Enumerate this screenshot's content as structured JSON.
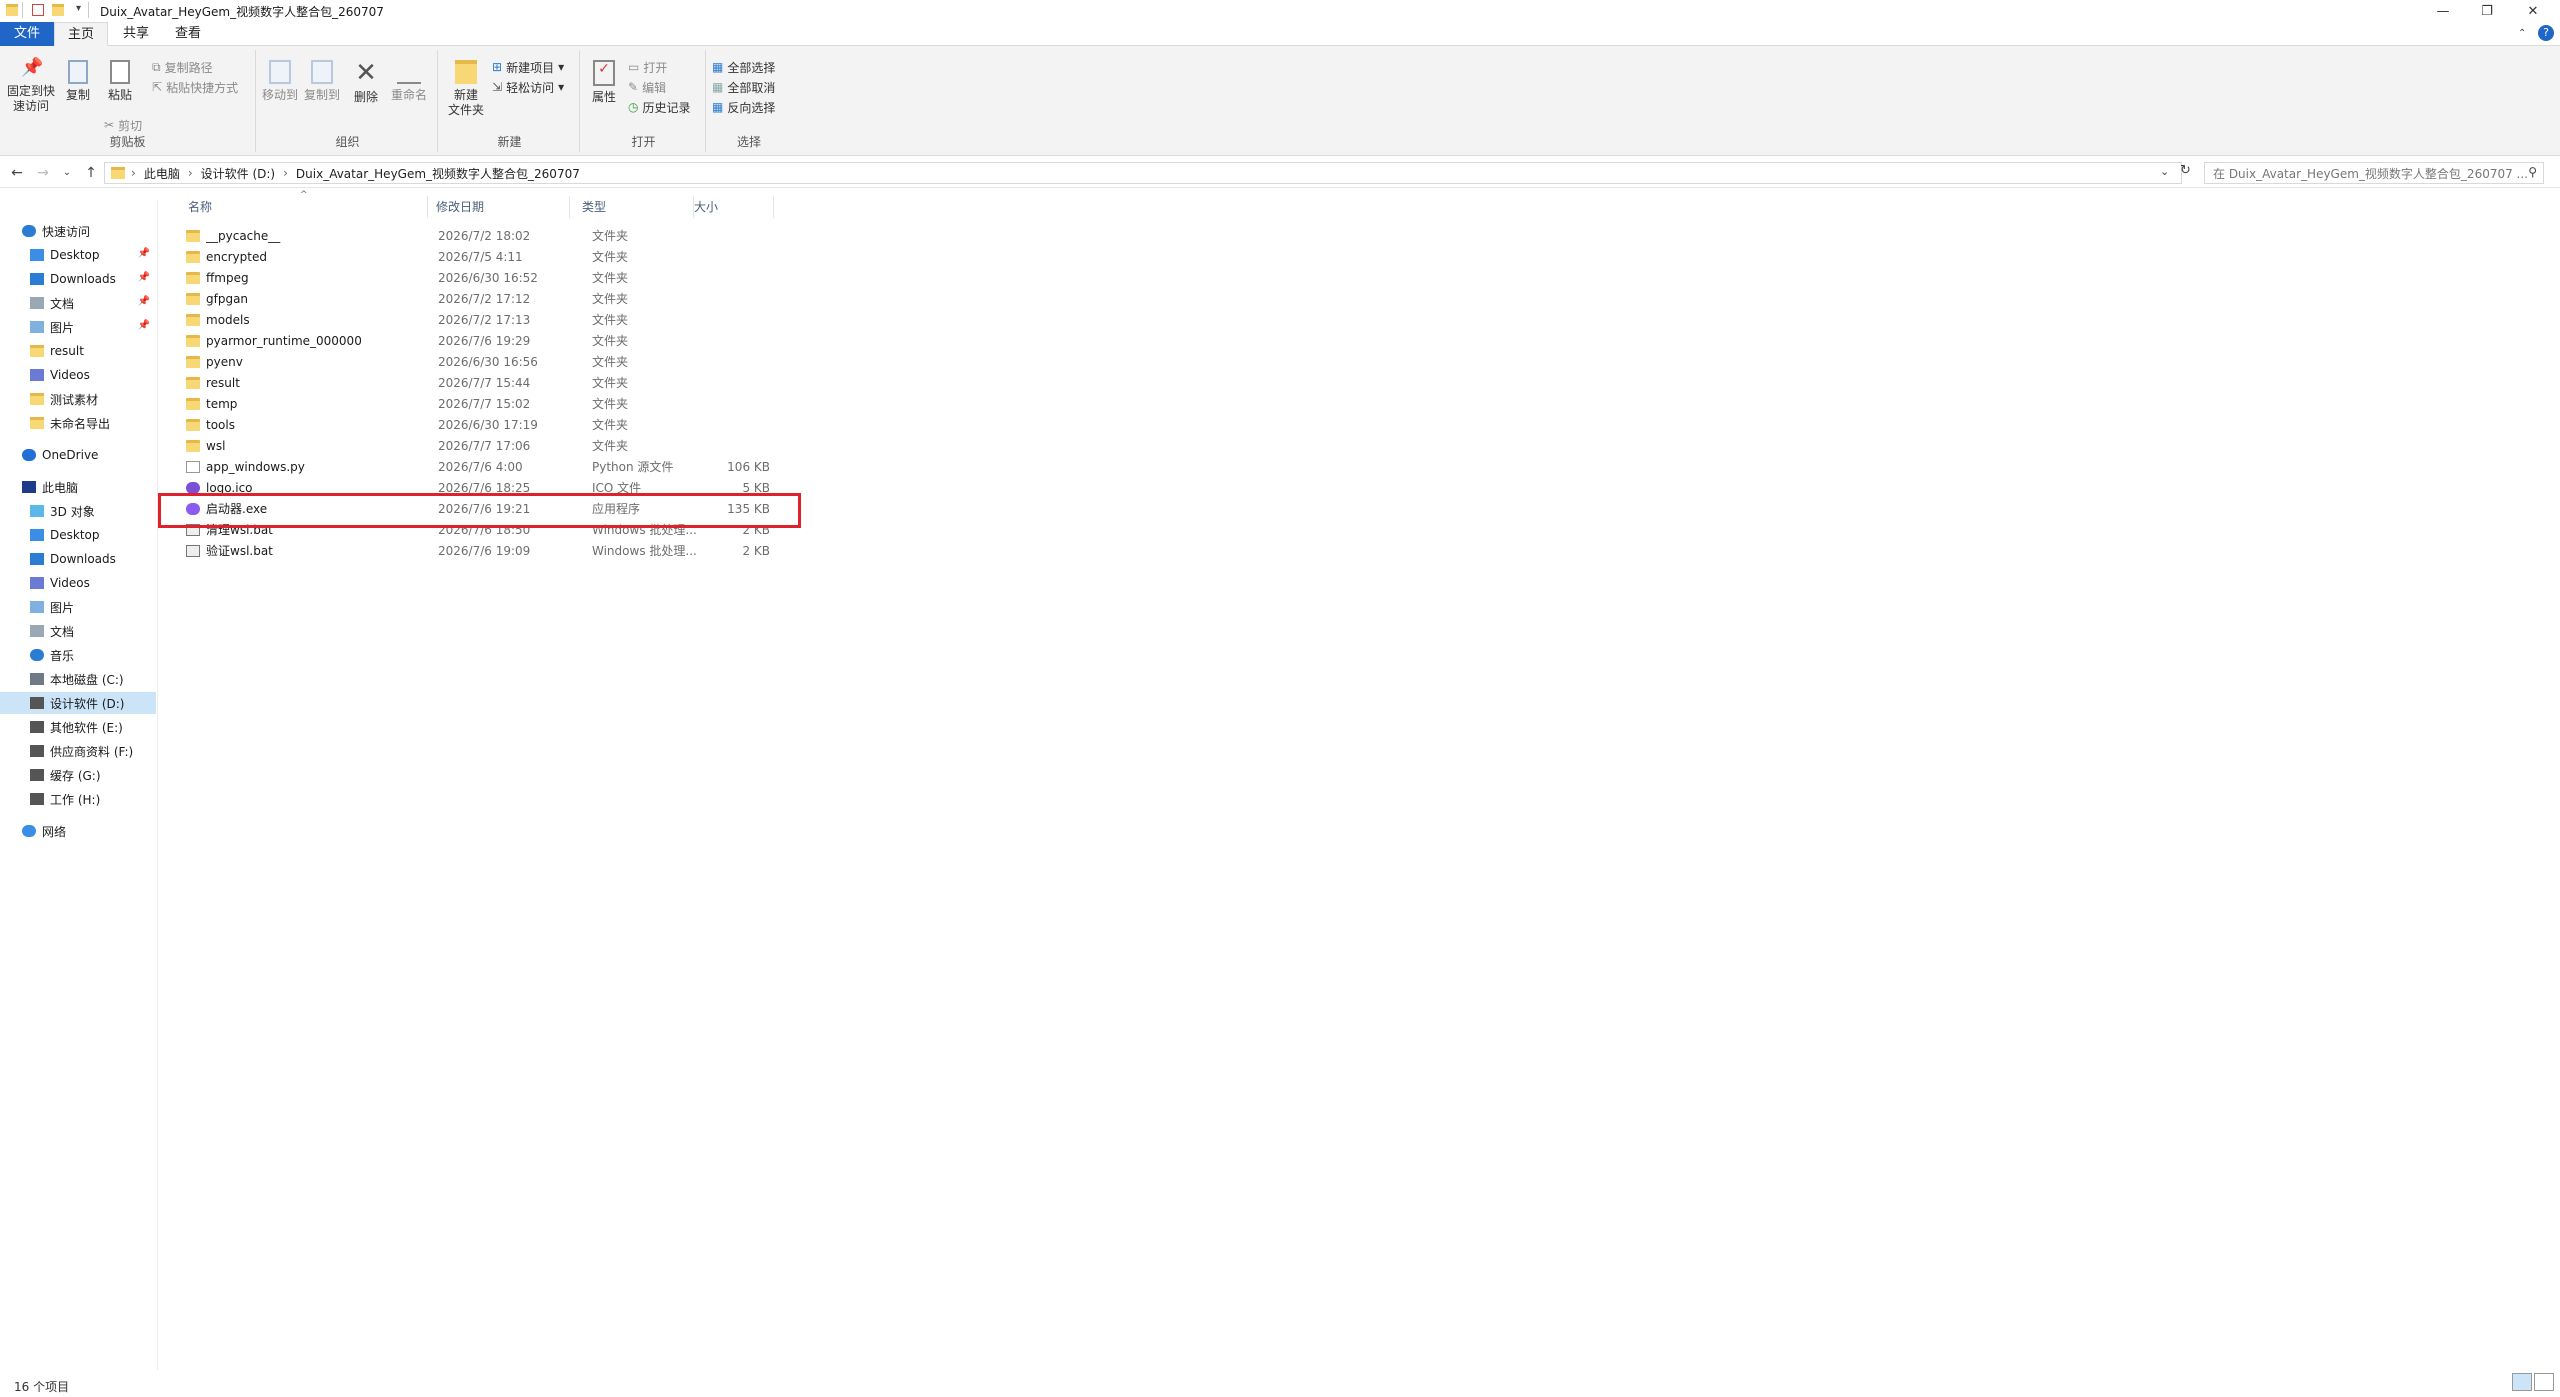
{
  "window": {
    "title": "Duix_Avatar_HeyGem_视频数字人整合包_260707",
    "controls": {
      "minimize": "—",
      "maximize": "❐",
      "close": "✕"
    }
  },
  "tabs": [
    {
      "label": "文件"
    },
    {
      "label": "主页"
    },
    {
      "label": "共享"
    },
    {
      "label": "查看"
    }
  ],
  "ribbon": {
    "clipboard": {
      "label": "剪贴板",
      "pin": "固定到快\n速访问",
      "copy": "复制",
      "paste": "粘贴",
      "copy_path": "复制路径",
      "paste_shortcut": "粘贴快捷方式",
      "cut": "剪切"
    },
    "organize": {
      "label": "组织",
      "move_to": "移动到",
      "copy_to": "复制到",
      "delete": "删除",
      "rename": "重命名"
    },
    "new": {
      "label": "新建",
      "new_folder": "新建\n文件夹",
      "new_item": "新建项目",
      "easy_access": "轻松访问"
    },
    "open": {
      "label": "打开",
      "properties": "属性",
      "open": "打开",
      "edit": "编辑",
      "history": "历史记录"
    },
    "select": {
      "label": "选择",
      "select_all": "全部选择",
      "select_none": "全部取消",
      "invert": "反向选择"
    }
  },
  "address": {
    "crumbs": [
      "此电脑",
      "设计软件 (D:)",
      "Duix_Avatar_HeyGem_视频数字人整合包_260707"
    ],
    "search_placeholder": "在 Duix_Avatar_HeyGem_视频数字人整合包_260707 ..."
  },
  "sidebar": {
    "items": [
      {
        "label": "快速访问",
        "icon": "star-icon",
        "color": "#2b7cd3"
      },
      {
        "label": "Desktop",
        "icon": "desktop-icon",
        "pinned": true,
        "color": "#3a8ee6"
      },
      {
        "label": "Downloads",
        "icon": "download-icon",
        "pinned": true,
        "color": "#2b7cd3"
      },
      {
        "label": "文档",
        "icon": "document-icon",
        "pinned": true,
        "color": "#9aa7b5"
      },
      {
        "label": "图片",
        "icon": "picture-icon",
        "pinned": true,
        "color": "#7fb0de"
      },
      {
        "label": "result",
        "icon": "folder-icon",
        "color": "#f8d775"
      },
      {
        "label": "Videos",
        "icon": "video-icon",
        "color": "#6a7bd6"
      },
      {
        "label": "测试素材",
        "icon": "folder-icon",
        "color": "#f8d775"
      },
      {
        "label": "未命名导出",
        "icon": "folder-icon",
        "color": "#f8d775"
      },
      {
        "label": "OneDrive",
        "icon": "cloud-icon",
        "color": "#1f6fd6"
      },
      {
        "label": "此电脑",
        "icon": "computer-icon",
        "color": "#1e3a8a"
      },
      {
        "label": "3D 对象",
        "icon": "cube-icon",
        "color": "#5bb7e8"
      },
      {
        "label": "Desktop",
        "icon": "desktop-icon",
        "color": "#3a8ee6"
      },
      {
        "label": "Downloads",
        "icon": "download-icon",
        "color": "#2b7cd3"
      },
      {
        "label": "Videos",
        "icon": "video-icon",
        "color": "#6a7bd6"
      },
      {
        "label": "图片",
        "icon": "picture-icon",
        "color": "#7fb0de"
      },
      {
        "label": "文档",
        "icon": "document-icon",
        "color": "#9aa7b5"
      },
      {
        "label": "音乐",
        "icon": "music-icon",
        "color": "#2b7cd3"
      },
      {
        "label": "本地磁盘 (C:)",
        "icon": "drive-icon",
        "color": "#6f7a86"
      },
      {
        "label": "设计软件 (D:)",
        "icon": "drive-icon",
        "selected": true,
        "color": "#555"
      },
      {
        "label": "其他软件 (E:)",
        "icon": "drive-icon",
        "color": "#555"
      },
      {
        "label": "供应商资料 (F:)",
        "icon": "drive-icon",
        "color": "#555"
      },
      {
        "label": "缓存 (G:)",
        "icon": "drive-icon",
        "color": "#555"
      },
      {
        "label": "工作 (H:)",
        "icon": "drive-icon",
        "color": "#555"
      },
      {
        "label": "网络",
        "icon": "network-icon",
        "color": "#3a8ee6"
      }
    ]
  },
  "columns": {
    "name": "名称",
    "date": "修改日期",
    "type": "类型",
    "size": "大小"
  },
  "files": [
    {
      "name": "__pycache__",
      "date": "2026/7/2 18:02",
      "type": "文件夹",
      "size": "",
      "kind": "folder"
    },
    {
      "name": "encrypted",
      "date": "2026/7/5 4:11",
      "type": "文件夹",
      "size": "",
      "kind": "folder"
    },
    {
      "name": "ffmpeg",
      "date": "2026/6/30 16:52",
      "type": "文件夹",
      "size": "",
      "kind": "folder"
    },
    {
      "name": "gfpgan",
      "date": "2026/7/2 17:12",
      "type": "文件夹",
      "size": "",
      "kind": "folder"
    },
    {
      "name": "models",
      "date": "2026/7/2 17:13",
      "type": "文件夹",
      "size": "",
      "kind": "folder"
    },
    {
      "name": "pyarmor_runtime_000000",
      "date": "2026/7/6 19:29",
      "type": "文件夹",
      "size": "",
      "kind": "folder"
    },
    {
      "name": "pyenv",
      "date": "2026/6/30 16:56",
      "type": "文件夹",
      "size": "",
      "kind": "folder"
    },
    {
      "name": "result",
      "date": "2026/7/7 15:44",
      "type": "文件夹",
      "size": "",
      "kind": "folder"
    },
    {
      "name": "temp",
      "date": "2026/7/7 15:02",
      "type": "文件夹",
      "size": "",
      "kind": "folder"
    },
    {
      "name": "tools",
      "date": "2026/6/30 17:19",
      "type": "文件夹",
      "size": "",
      "kind": "folder"
    },
    {
      "name": "wsl",
      "date": "2026/7/7 17:06",
      "type": "文件夹",
      "size": "",
      "kind": "folder"
    },
    {
      "name": "app_windows.py",
      "date": "2026/7/6 4:00",
      "type": "Python 源文件",
      "size": "106 KB",
      "kind": "py"
    },
    {
      "name": "logo.ico",
      "date": "2026/7/6 18:25",
      "type": "ICO 文件",
      "size": "5 KB",
      "kind": "ico"
    },
    {
      "name": "启动器.exe",
      "date": "2026/7/6 19:21",
      "type": "应用程序",
      "size": "135 KB",
      "kind": "exe"
    },
    {
      "name": "清理wsl.bat",
      "date": "2026/7/6 18:50",
      "type": "Windows 批处理...",
      "size": "2 KB",
      "kind": "bat"
    },
    {
      "name": "验证wsl.bat",
      "date": "2026/7/6 19:09",
      "type": "Windows 批处理...",
      "size": "2 KB",
      "kind": "bat"
    }
  ],
  "status": {
    "count": "16 个项目"
  },
  "colors": {
    "accent": "#1f66c7",
    "highlight": "#e0202a",
    "selected": "#cce4f7",
    "folder": "#f8d775"
  }
}
